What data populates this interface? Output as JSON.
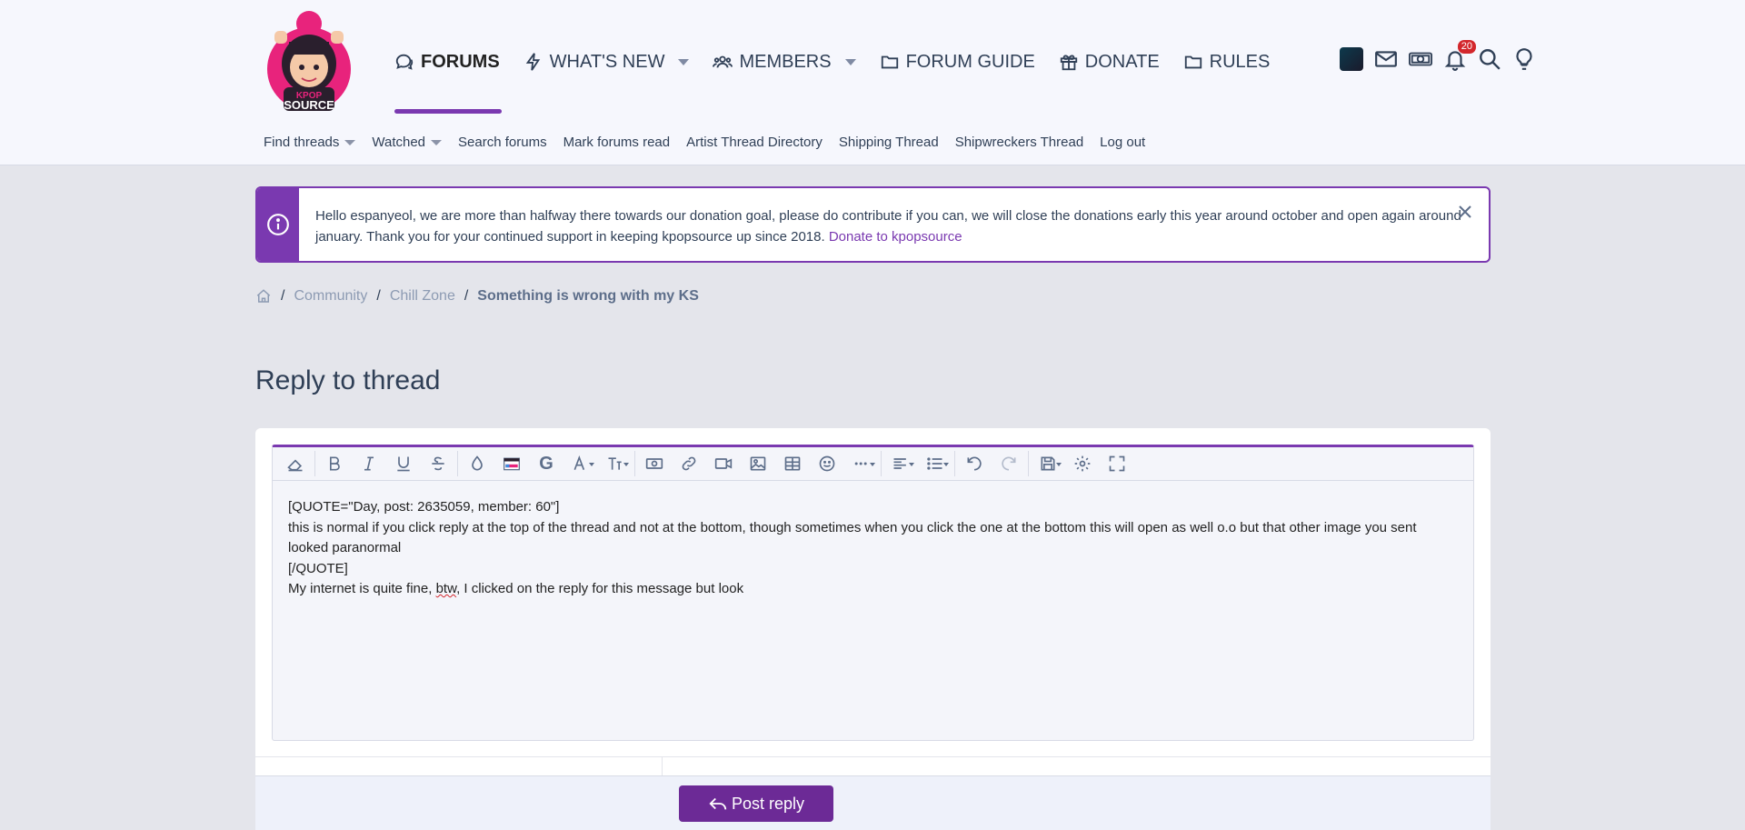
{
  "nav": {
    "items": [
      {
        "label": "FORUMS",
        "icon": "comments-icon"
      },
      {
        "label": "WHAT'S NEW",
        "icon": "bolt-icon"
      },
      {
        "label": "MEMBERS",
        "icon": "users-icon"
      },
      {
        "label": "FORUM GUIDE",
        "icon": "folder-icon"
      },
      {
        "label": "DONATE",
        "icon": "gift-icon"
      },
      {
        "label": "RULES",
        "icon": "folder-icon"
      }
    ],
    "notifications_count": "20"
  },
  "logo": {
    "line1": "KPOP",
    "line2": "SOURCE"
  },
  "subnav": {
    "items": [
      "Find threads",
      "Watched",
      "Search forums",
      "Mark forums read",
      "Artist Thread Directory",
      "Shipping Thread",
      "Shipwreckers Thread",
      "Log out"
    ]
  },
  "notice": {
    "text": "Hello espanyeol, we are more than halfway there towards our donation goal, please do contribute if you can, we will close the donations early this year around october and open again around january. Thank you for your continued support in keeping kpopsource up since 2018.",
    "link": "Donate to kpopsource"
  },
  "breadcrumb": {
    "items": [
      "Community",
      "Chill Zone",
      "Something is wrong with my KS"
    ]
  },
  "page_title": "Reply to thread",
  "editor": {
    "line1": "[QUOTE=\"Day, post: 2635059, member: 60\"]",
    "line2": "this is normal if you click reply at the top of the thread and not at the bottom, though sometimes when you click the one at the bottom this will open as well o.o but that other image you sent looked paranormal",
    "line3": "[/QUOTE]",
    "line4_a": "My internet is quite fine, ",
    "line4_spell": "btw",
    "line4_b": ", I clicked on the reply for this message but look",
    "toolbar_g_label": "G"
  },
  "post_button": "Post reply",
  "colors": {
    "accent": "#7a39b0",
    "button": "#6c2a96",
    "badge": "#d3272c"
  }
}
